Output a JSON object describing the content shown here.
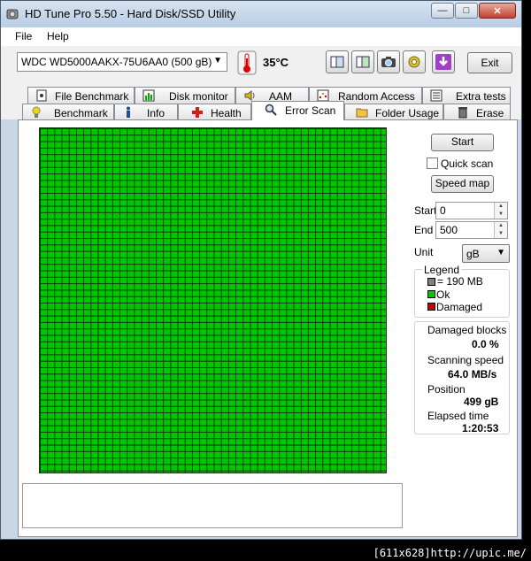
{
  "window": {
    "title": "HD Tune Pro 5.50 - Hard Disk/SSD Utility"
  },
  "menu": {
    "file": "File",
    "help": "Help"
  },
  "toolbar": {
    "drive": "WDC WD5000AAKX-75U6AA0 (500 gB)",
    "temperature": "35",
    "temperature_unit": "°C",
    "exit_label": "Exit"
  },
  "tabs_top": [
    "File Benchmark",
    "Disk monitor",
    "AAM",
    "Random Access",
    "Extra tests"
  ],
  "tabs_bottom": [
    "Benchmark",
    "Info",
    "Health",
    "Error Scan",
    "Folder Usage",
    "Erase"
  ],
  "active_tab": "Error Scan",
  "scan": {
    "start_button": "Start",
    "quick_scan_label": "Quick scan",
    "quick_scan_checked": false,
    "speed_map_button": "Speed map",
    "start_label": "Start",
    "start_value": "0",
    "end_label": "End",
    "end_value": "500",
    "unit_label": "Unit",
    "unit_value": "gB",
    "block_color_ok": "#00c800",
    "block_color_damaged": "#c80000",
    "block_color_size": "#808080"
  },
  "legend": {
    "title": "Legend",
    "size_text": "= 190 MB",
    "ok_text": "Ok",
    "damaged_text": "Damaged"
  },
  "stats": {
    "damaged_blocks_label": "Damaged blocks",
    "damaged_blocks_value": "0.0 %",
    "scanning_speed_label": "Scanning speed",
    "scanning_speed_value": "64.0 MB/s",
    "position_label": "Position",
    "position_value": "499 gB",
    "elapsed_label": "Elapsed time",
    "elapsed_value": "1:20:53"
  },
  "footer": {
    "watermark": "[611x628]http://upic.me/"
  }
}
